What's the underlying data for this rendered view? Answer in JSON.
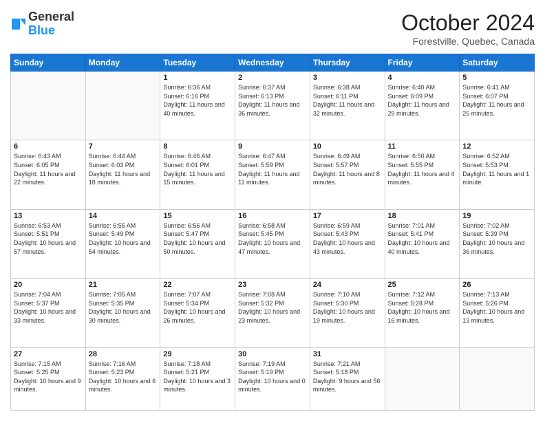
{
  "header": {
    "logo_line1": "General",
    "logo_line2": "Blue",
    "month": "October 2024",
    "location": "Forestville, Quebec, Canada"
  },
  "weekdays": [
    "Sunday",
    "Monday",
    "Tuesday",
    "Wednesday",
    "Thursday",
    "Friday",
    "Saturday"
  ],
  "weeks": [
    [
      {
        "day": "",
        "sunrise": "",
        "sunset": "",
        "daylight": ""
      },
      {
        "day": "",
        "sunrise": "",
        "sunset": "",
        "daylight": ""
      },
      {
        "day": "1",
        "sunrise": "Sunrise: 6:36 AM",
        "sunset": "Sunset: 6:16 PM",
        "daylight": "Daylight: 11 hours and 40 minutes."
      },
      {
        "day": "2",
        "sunrise": "Sunrise: 6:37 AM",
        "sunset": "Sunset: 6:13 PM",
        "daylight": "Daylight: 11 hours and 36 minutes."
      },
      {
        "day": "3",
        "sunrise": "Sunrise: 6:38 AM",
        "sunset": "Sunset: 6:11 PM",
        "daylight": "Daylight: 11 hours and 32 minutes."
      },
      {
        "day": "4",
        "sunrise": "Sunrise: 6:40 AM",
        "sunset": "Sunset: 6:09 PM",
        "daylight": "Daylight: 11 hours and 29 minutes."
      },
      {
        "day": "5",
        "sunrise": "Sunrise: 6:41 AM",
        "sunset": "Sunset: 6:07 PM",
        "daylight": "Daylight: 11 hours and 25 minutes."
      }
    ],
    [
      {
        "day": "6",
        "sunrise": "Sunrise: 6:43 AM",
        "sunset": "Sunset: 6:05 PM",
        "daylight": "Daylight: 11 hours and 22 minutes."
      },
      {
        "day": "7",
        "sunrise": "Sunrise: 6:44 AM",
        "sunset": "Sunset: 6:03 PM",
        "daylight": "Daylight: 11 hours and 18 minutes."
      },
      {
        "day": "8",
        "sunrise": "Sunrise: 6:46 AM",
        "sunset": "Sunset: 6:01 PM",
        "daylight": "Daylight: 11 hours and 15 minutes."
      },
      {
        "day": "9",
        "sunrise": "Sunrise: 6:47 AM",
        "sunset": "Sunset: 5:59 PM",
        "daylight": "Daylight: 11 hours and 11 minutes."
      },
      {
        "day": "10",
        "sunrise": "Sunrise: 6:49 AM",
        "sunset": "Sunset: 5:57 PM",
        "daylight": "Daylight: 11 hours and 8 minutes."
      },
      {
        "day": "11",
        "sunrise": "Sunrise: 6:50 AM",
        "sunset": "Sunset: 5:55 PM",
        "daylight": "Daylight: 11 hours and 4 minutes."
      },
      {
        "day": "12",
        "sunrise": "Sunrise: 6:52 AM",
        "sunset": "Sunset: 5:53 PM",
        "daylight": "Daylight: 11 hours and 1 minute."
      }
    ],
    [
      {
        "day": "13",
        "sunrise": "Sunrise: 6:53 AM",
        "sunset": "Sunset: 5:51 PM",
        "daylight": "Daylight: 10 hours and 57 minutes."
      },
      {
        "day": "14",
        "sunrise": "Sunrise: 6:55 AM",
        "sunset": "Sunset: 5:49 PM",
        "daylight": "Daylight: 10 hours and 54 minutes."
      },
      {
        "day": "15",
        "sunrise": "Sunrise: 6:56 AM",
        "sunset": "Sunset: 5:47 PM",
        "daylight": "Daylight: 10 hours and 50 minutes."
      },
      {
        "day": "16",
        "sunrise": "Sunrise: 6:58 AM",
        "sunset": "Sunset: 5:45 PM",
        "daylight": "Daylight: 10 hours and 47 minutes."
      },
      {
        "day": "17",
        "sunrise": "Sunrise: 6:59 AM",
        "sunset": "Sunset: 5:43 PM",
        "daylight": "Daylight: 10 hours and 43 minutes."
      },
      {
        "day": "18",
        "sunrise": "Sunrise: 7:01 AM",
        "sunset": "Sunset: 5:41 PM",
        "daylight": "Daylight: 10 hours and 40 minutes."
      },
      {
        "day": "19",
        "sunrise": "Sunrise: 7:02 AM",
        "sunset": "Sunset: 5:39 PM",
        "daylight": "Daylight: 10 hours and 36 minutes."
      }
    ],
    [
      {
        "day": "20",
        "sunrise": "Sunrise: 7:04 AM",
        "sunset": "Sunset: 5:37 PM",
        "daylight": "Daylight: 10 hours and 33 minutes."
      },
      {
        "day": "21",
        "sunrise": "Sunrise: 7:05 AM",
        "sunset": "Sunset: 5:35 PM",
        "daylight": "Daylight: 10 hours and 30 minutes."
      },
      {
        "day": "22",
        "sunrise": "Sunrise: 7:07 AM",
        "sunset": "Sunset: 5:34 PM",
        "daylight": "Daylight: 10 hours and 26 minutes."
      },
      {
        "day": "23",
        "sunrise": "Sunrise: 7:08 AM",
        "sunset": "Sunset: 5:32 PM",
        "daylight": "Daylight: 10 hours and 23 minutes."
      },
      {
        "day": "24",
        "sunrise": "Sunrise: 7:10 AM",
        "sunset": "Sunset: 5:30 PM",
        "daylight": "Daylight: 10 hours and 19 minutes."
      },
      {
        "day": "25",
        "sunrise": "Sunrise: 7:12 AM",
        "sunset": "Sunset: 5:28 PM",
        "daylight": "Daylight: 10 hours and 16 minutes."
      },
      {
        "day": "26",
        "sunrise": "Sunrise: 7:13 AM",
        "sunset": "Sunset: 5:26 PM",
        "daylight": "Daylight: 10 hours and 13 minutes."
      }
    ],
    [
      {
        "day": "27",
        "sunrise": "Sunrise: 7:15 AM",
        "sunset": "Sunset: 5:25 PM",
        "daylight": "Daylight: 10 hours and 9 minutes."
      },
      {
        "day": "28",
        "sunrise": "Sunrise: 7:16 AM",
        "sunset": "Sunset: 5:23 PM",
        "daylight": "Daylight: 10 hours and 6 minutes."
      },
      {
        "day": "29",
        "sunrise": "Sunrise: 7:18 AM",
        "sunset": "Sunset: 5:21 PM",
        "daylight": "Daylight: 10 hours and 3 minutes."
      },
      {
        "day": "30",
        "sunrise": "Sunrise: 7:19 AM",
        "sunset": "Sunset: 5:19 PM",
        "daylight": "Daylight: 10 hours and 0 minutes."
      },
      {
        "day": "31",
        "sunrise": "Sunrise: 7:21 AM",
        "sunset": "Sunset: 5:18 PM",
        "daylight": "Daylight: 9 hours and 56 minutes."
      },
      {
        "day": "",
        "sunrise": "",
        "sunset": "",
        "daylight": ""
      },
      {
        "day": "",
        "sunrise": "",
        "sunset": "",
        "daylight": ""
      }
    ]
  ]
}
